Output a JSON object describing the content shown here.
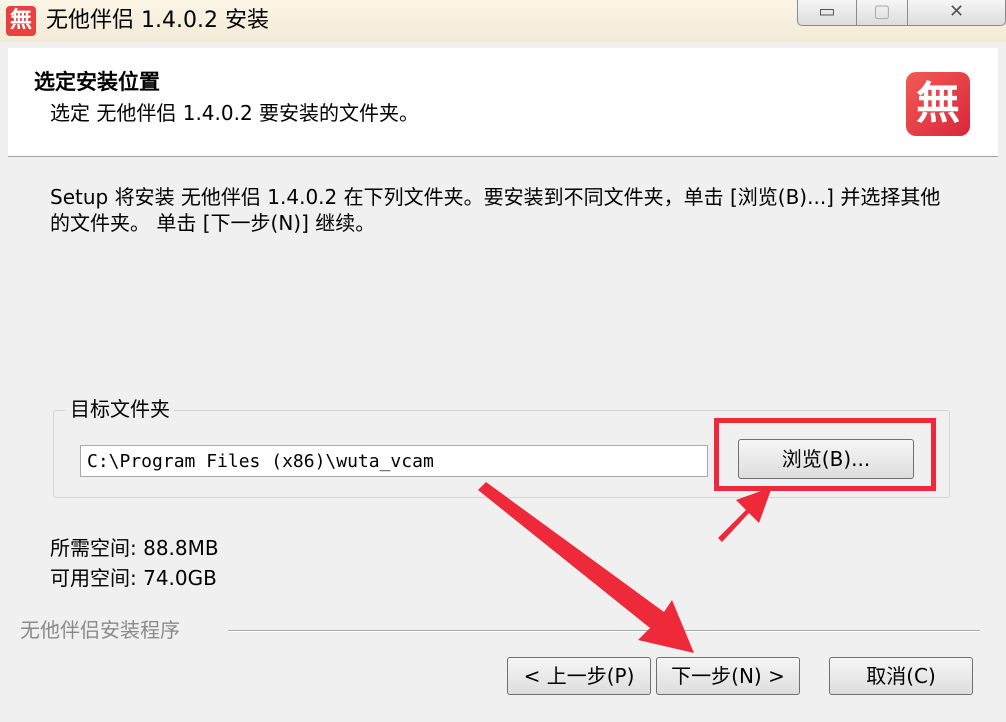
{
  "window": {
    "title": "无他伴侣 1.4.0.2 安装",
    "app_icon_glyph": "無",
    "minimize_glyph": "▭",
    "maximize_glyph": "▢",
    "close_glyph": "✕"
  },
  "header": {
    "title": "选定安装位置",
    "subtitle": "选定 无他伴侣 1.4.0.2 要安装的文件夹。",
    "logo_glyph": "無"
  },
  "body": {
    "instructions": "Setup 将安装 无他伴侣 1.4.0.2 在下列文件夹。要安装到不同文件夹，单击 [浏览(B)...] 并选择其他的文件夹。 单击 [下一步(N)] 继续。",
    "destination_label": "目标文件夹",
    "destination_path": "C:\\Program Files (x86)\\wuta_vcam",
    "browse_label": "浏览(B)...",
    "space_required": "所需空间: 88.8MB",
    "space_available": "可用空间: 74.0GB"
  },
  "footer": {
    "brand": "无他伴侣安装程序",
    "back_label": "< 上一步(P)",
    "next_label": "下一步(N) >",
    "cancel_label": "取消(C)"
  },
  "colors": {
    "annotation_red": "#ee2a3a",
    "brand_red": "#e8413f"
  }
}
